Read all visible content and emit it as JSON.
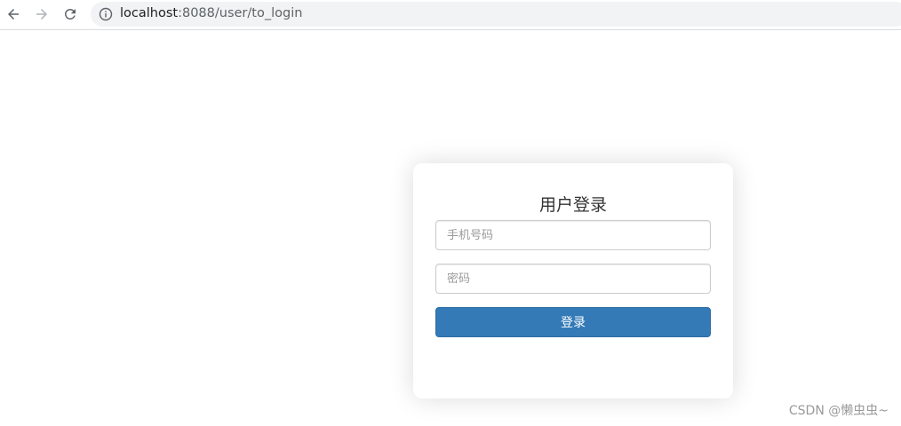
{
  "browser": {
    "url_host": "localhost",
    "url_rest": ":8088/user/to_login",
    "icons": {
      "back": "arrow-left-icon",
      "forward": "arrow-right-icon",
      "reload": "reload-icon",
      "info": "info-icon"
    }
  },
  "login": {
    "title": "用户登录",
    "phone_placeholder": "手机号码",
    "password_placeholder": "密码",
    "submit_label": "登录"
  },
  "watermark": "CSDN @懒虫虫~",
  "colors": {
    "primary_button": "#337ab7",
    "address_bar_bg": "#f1f3f4"
  }
}
